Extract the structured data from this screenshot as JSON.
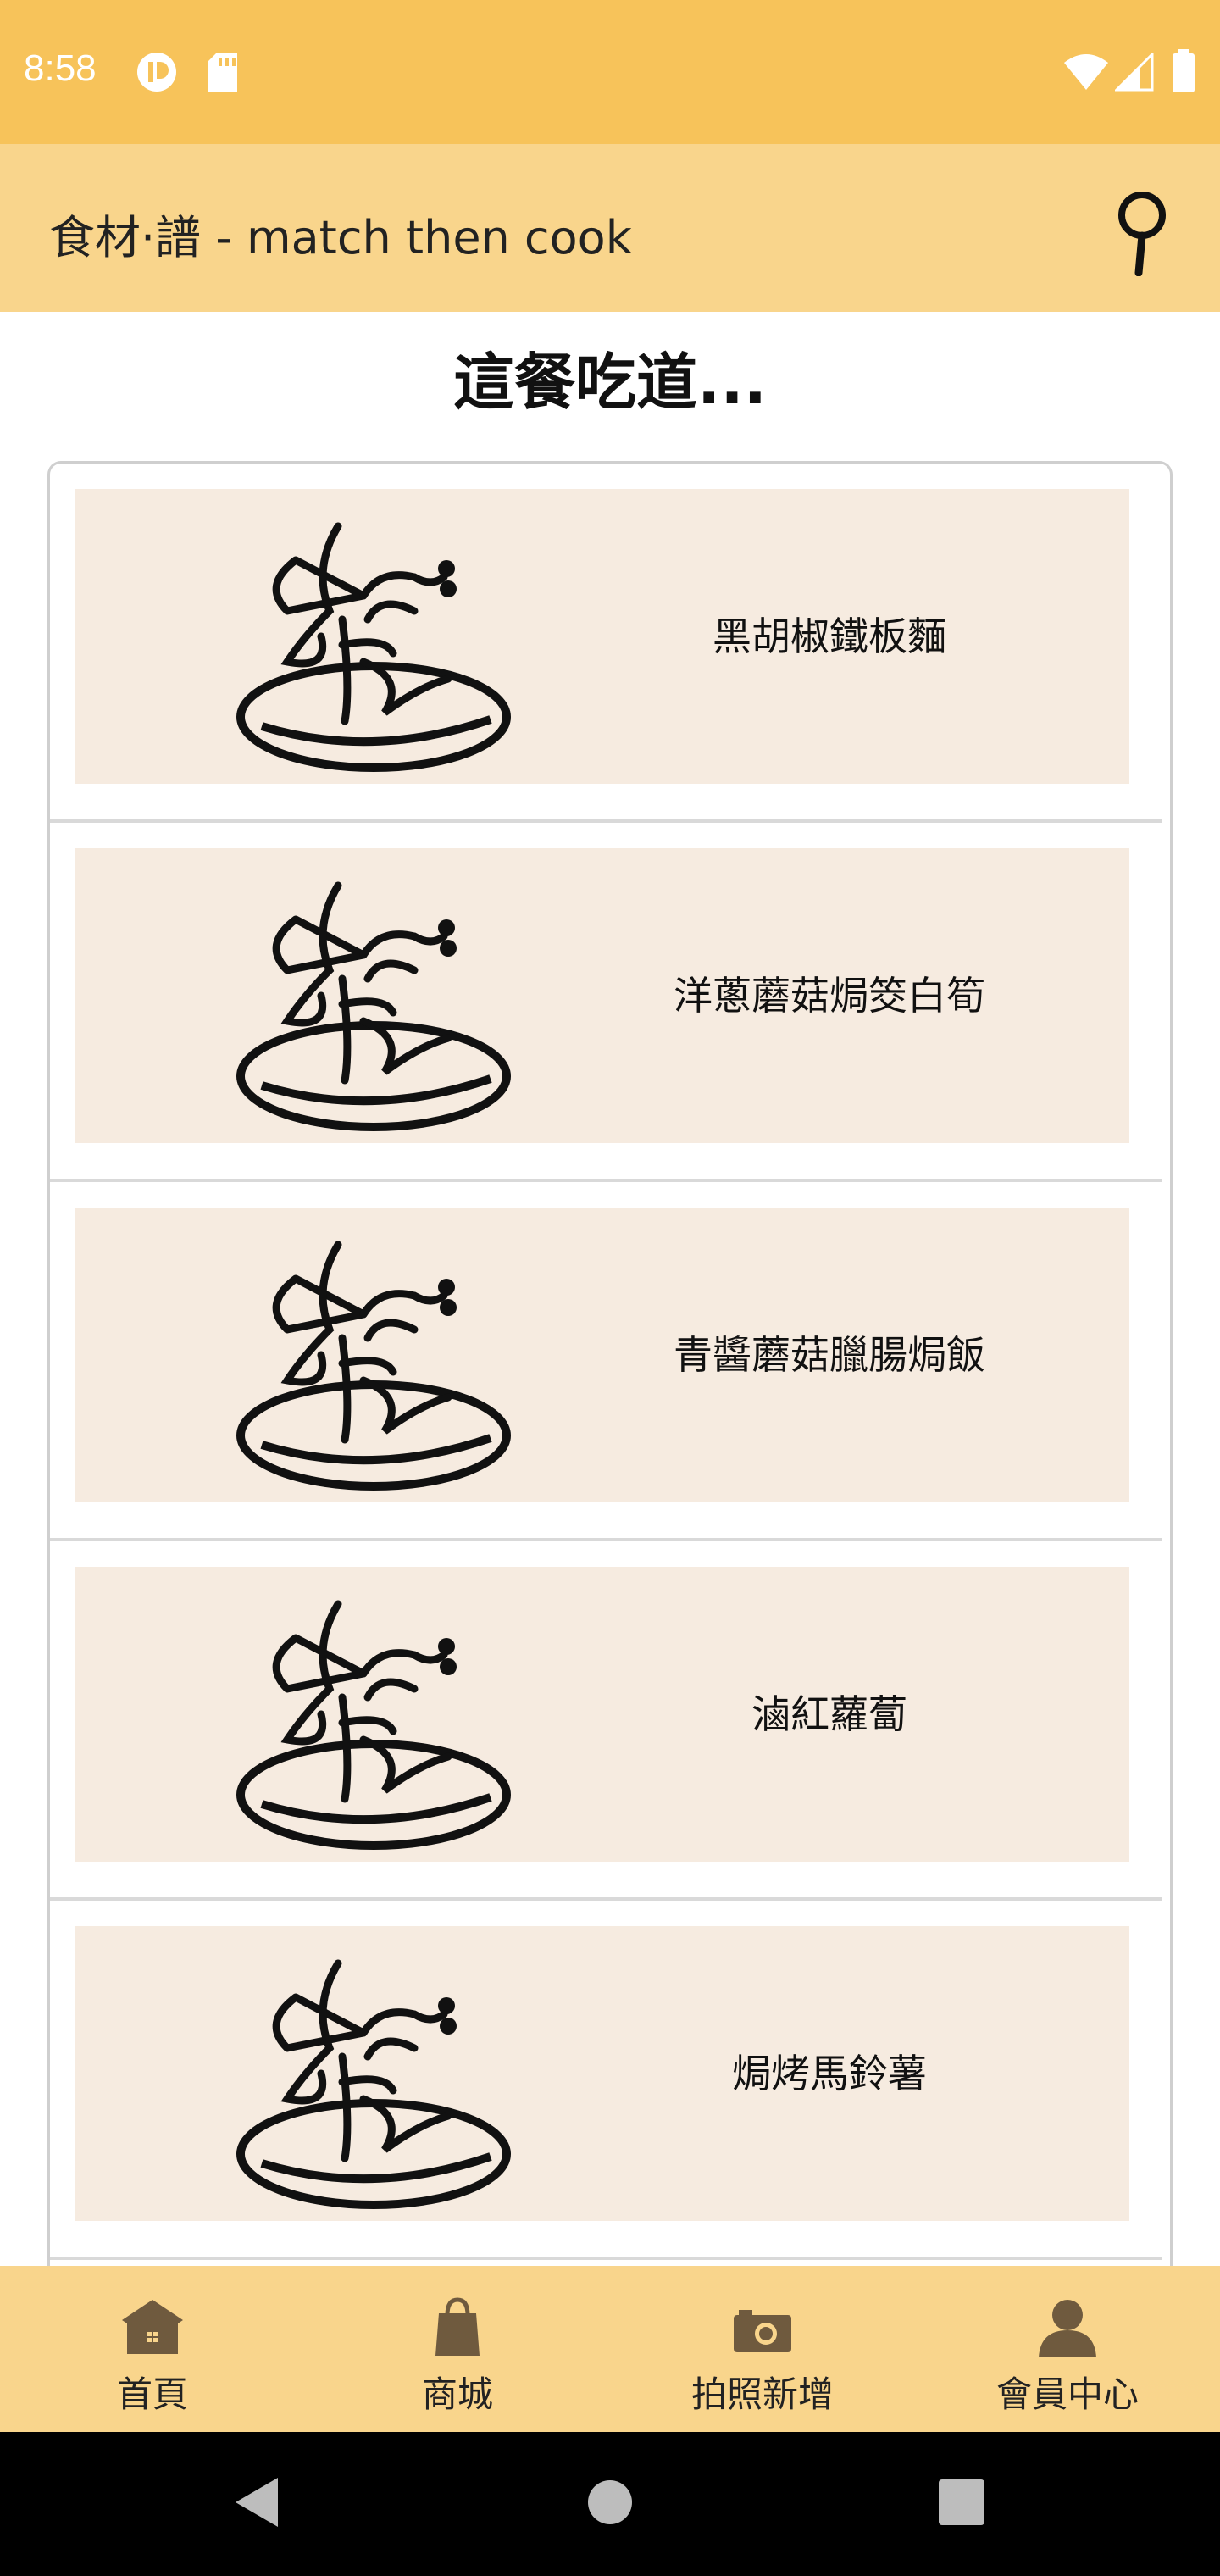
{
  "status_bar": {
    "time": "8:58",
    "icons": [
      "notification-app-icon",
      "sd-card-icon",
      "wifi-icon",
      "cell-signal-icon",
      "battery-icon"
    ],
    "background_color": "#F7C35A"
  },
  "app_bar": {
    "title": "食材·譜 - match then cook",
    "search_icon": "search-icon",
    "background_color": "#F9D58C"
  },
  "main": {
    "heading": "這餐吃道...",
    "recipes": [
      {
        "name": "黑胡椒鐵板麵",
        "image": "dish-logo"
      },
      {
        "name": "洋蔥蘑菇焗筊白筍",
        "image": "dish-logo"
      },
      {
        "name": "青醬蘑菇臘腸焗飯",
        "image": "dish-logo"
      },
      {
        "name": "滷紅蘿蔔",
        "image": "dish-logo"
      },
      {
        "name": "焗烤馬鈴薯",
        "image": "dish-logo"
      }
    ],
    "card_color": "#F6EBE0"
  },
  "bottom_nav": {
    "items": [
      {
        "label": "首頁",
        "icon": "home-icon"
      },
      {
        "label": "商城",
        "icon": "shopping-bag-icon"
      },
      {
        "label": "拍照新增",
        "icon": "camera-icon"
      },
      {
        "label": "會員中心",
        "icon": "person-icon"
      }
    ]
  },
  "system_nav": {
    "buttons": [
      "back-icon",
      "home-circle-icon",
      "recents-icon"
    ]
  }
}
